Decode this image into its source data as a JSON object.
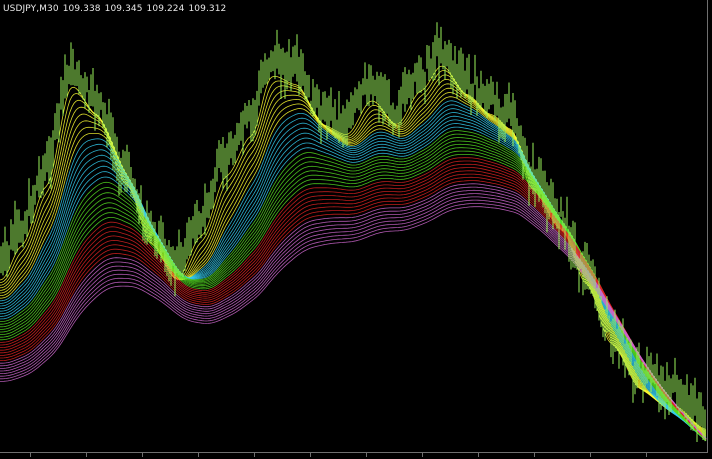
{
  "chart_header": {
    "symbol_timeframe": "USDJPY,M30",
    "open": "109.338",
    "high": "109.345",
    "low": "109.224",
    "close": "109.312"
  },
  "colors": {
    "background": "#000000",
    "price_bars": "#9AF25A",
    "ribbon_bands": [
      "#FFFF33",
      "#33CCEE",
      "#55DD22",
      "#DD2222",
      "#CC66CC"
    ]
  }
}
